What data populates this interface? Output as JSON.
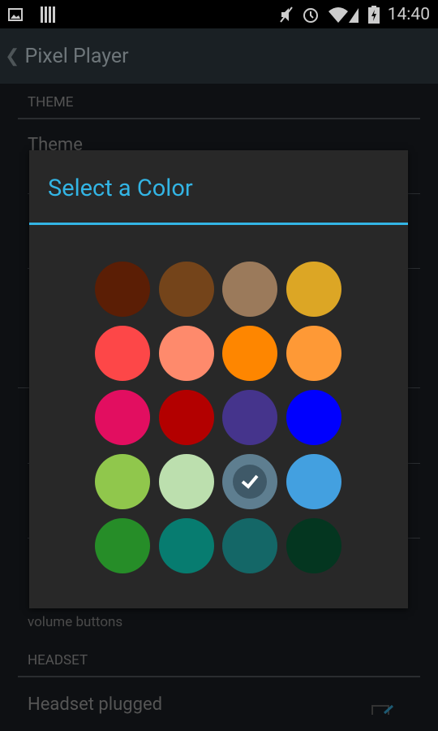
{
  "status_bar": {
    "time": "14:40",
    "icons": [
      "image-icon",
      "barcode-icon",
      "mute-icon",
      "alarm-icon",
      "wifi-icon",
      "signal-icon",
      "battery-charging-icon"
    ]
  },
  "app_bar": {
    "title": "Pixel Player",
    "back_icon": "chevron-left-icon"
  },
  "settings": {
    "theme_header": "THEME",
    "theme_item": "Theme",
    "volume_desc_line2": "volume buttons",
    "headset_header": "HEADSET",
    "headset_item": "Headset plugged"
  },
  "dialog": {
    "title": "Select a Color",
    "accent": "#33b5e5",
    "colors": [
      "#5b1e05",
      "#74441a",
      "#9b7a5b",
      "#dca625",
      "#fd4748",
      "#fe8a6c",
      "#fe8600",
      "#fe9936",
      "#e20e60",
      "#b30000",
      "#45348c",
      "#0000fe",
      "#90c74c",
      "#bcdfae",
      "#5e7e90",
      "#43a0e0",
      "#268d28",
      "#077c70",
      "#146767",
      "#043620"
    ],
    "selected_index": 14
  }
}
